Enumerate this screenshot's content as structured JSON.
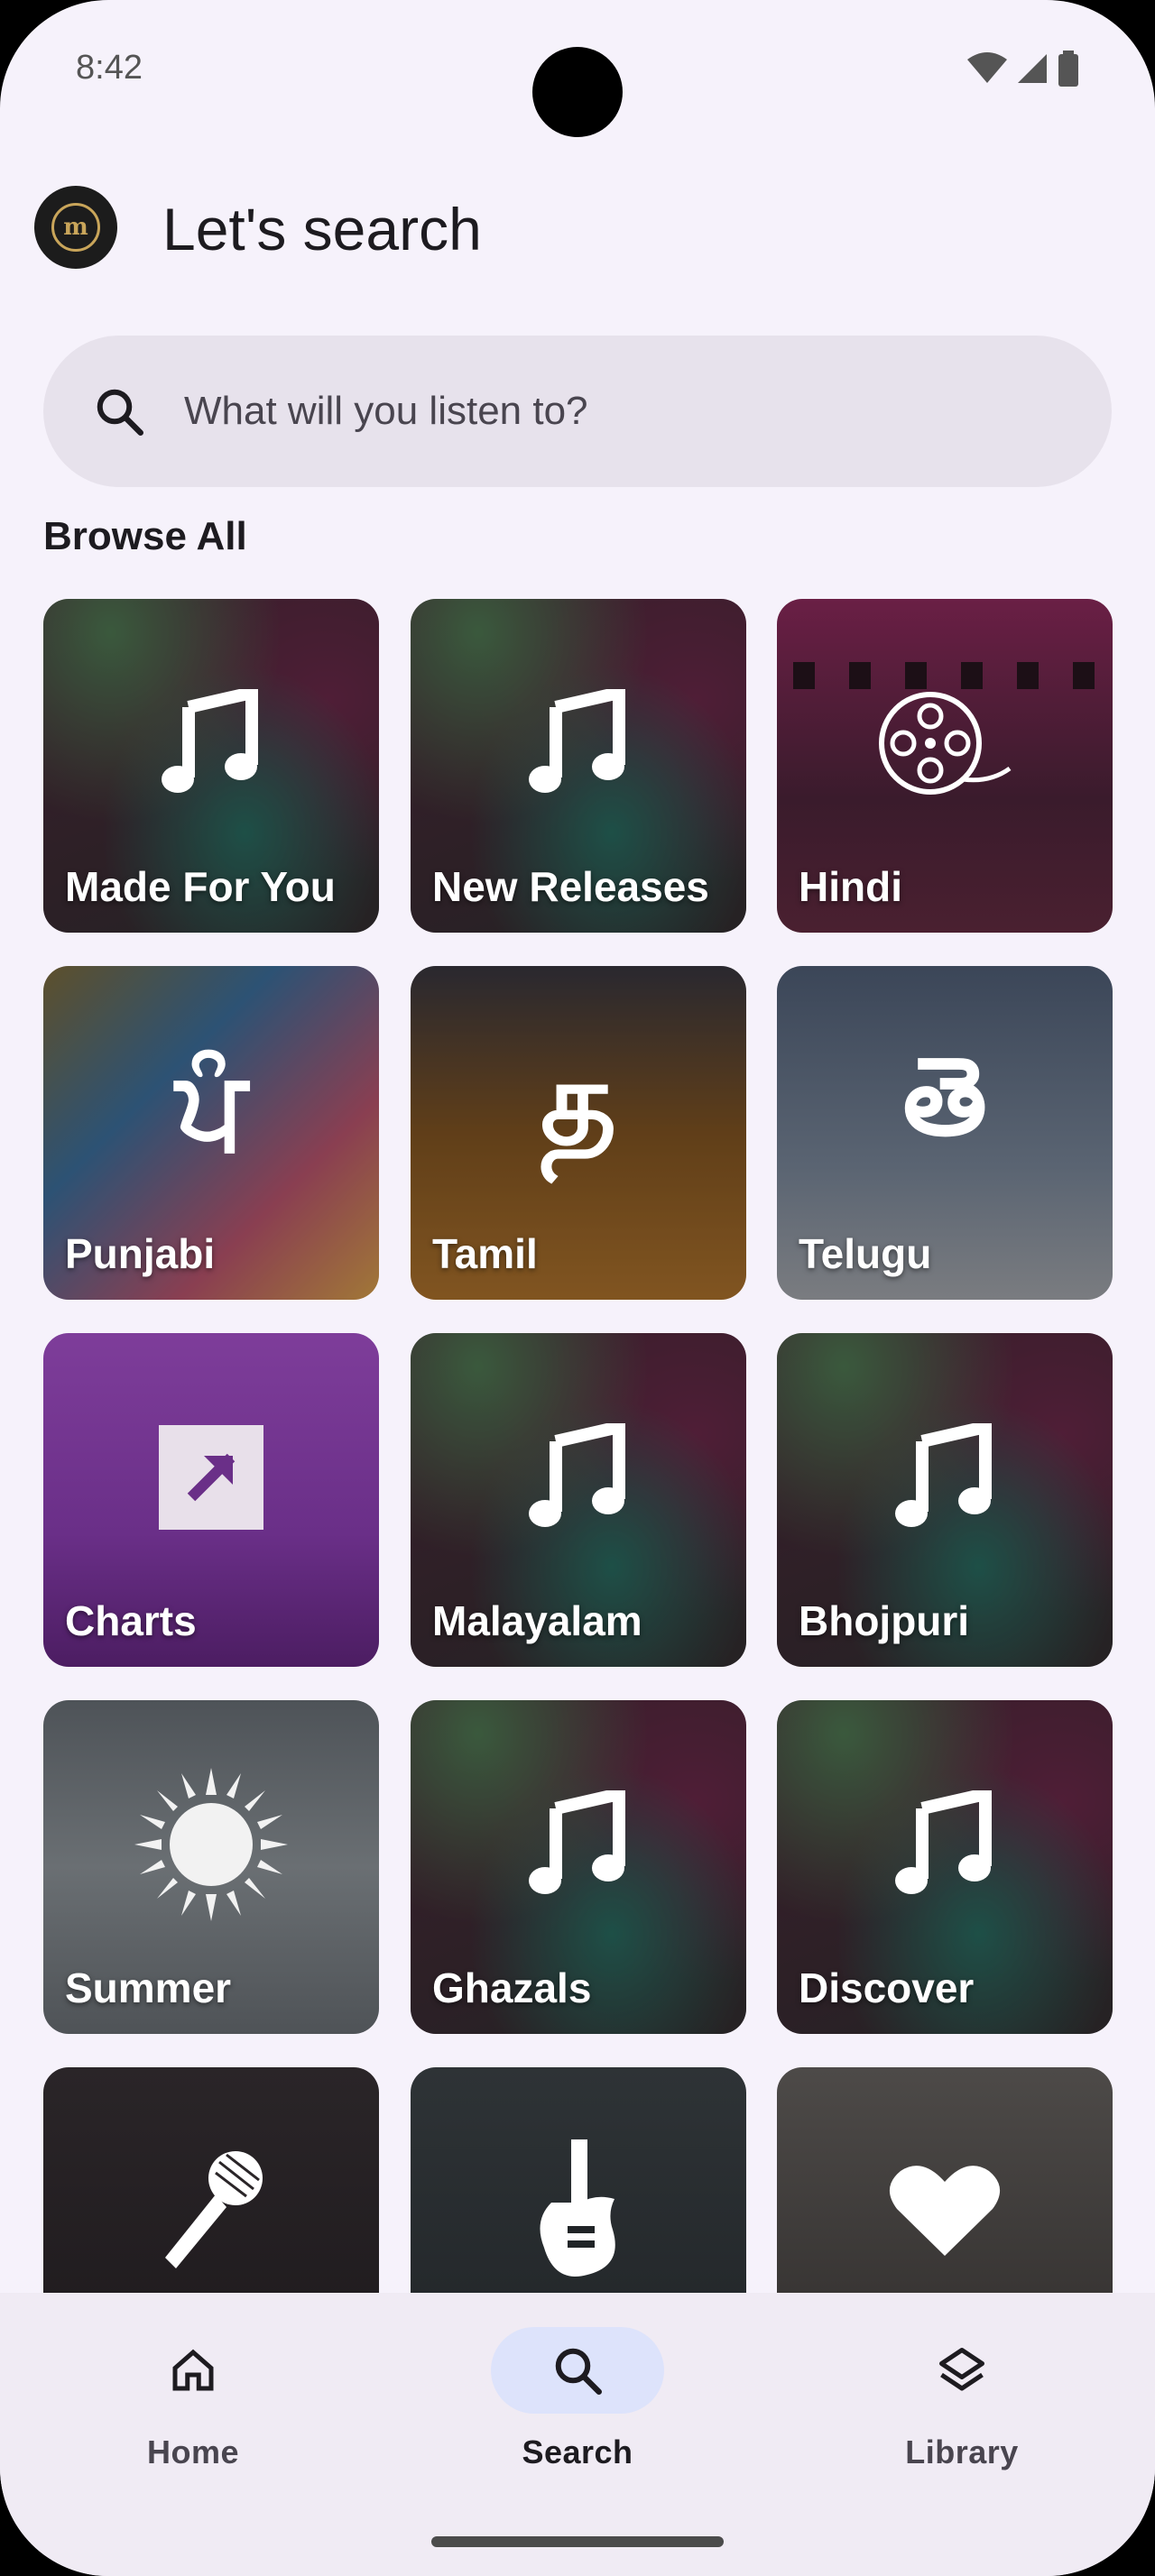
{
  "status_bar": {
    "time": "8:42"
  },
  "header": {
    "title": "Let's search",
    "logo_text": "m"
  },
  "search": {
    "placeholder": "What will you listen to?"
  },
  "browse": {
    "title": "Browse All",
    "tiles": [
      {
        "label": "Made For You",
        "icon": "music-note-icon"
      },
      {
        "label": "New Releases",
        "icon": "music-note-icon"
      },
      {
        "label": "Hindi",
        "icon": "film-reel-icon"
      },
      {
        "label": "Punjabi",
        "icon": "gurmukhi-letter-icon",
        "glyph": "ਪੰ"
      },
      {
        "label": "Tamil",
        "icon": "tamil-letter-icon",
        "glyph": "த"
      },
      {
        "label": "Telugu",
        "icon": "telugu-letter-icon",
        "glyph": "తె"
      },
      {
        "label": "Charts",
        "icon": "trending-arrow-icon"
      },
      {
        "label": "Malayalam",
        "icon": "music-note-icon"
      },
      {
        "label": "Bhojpuri",
        "icon": "music-note-icon"
      },
      {
        "label": "Summer",
        "icon": "sun-icon"
      },
      {
        "label": "Ghazals",
        "icon": "music-note-icon"
      },
      {
        "label": "Discover",
        "icon": "music-note-icon"
      },
      {
        "label": "",
        "icon": "microphone-icon"
      },
      {
        "label": "",
        "icon": "guitar-icon"
      },
      {
        "label": "",
        "icon": "heart-icon"
      }
    ]
  },
  "bottom_nav": {
    "items": [
      {
        "label": "Home",
        "icon": "home-icon"
      },
      {
        "label": "Search",
        "icon": "search-icon",
        "active": true
      },
      {
        "label": "Library",
        "icon": "layers-icon"
      }
    ]
  },
  "colors": {
    "background": "#f6f2fb",
    "search_bar": "#e7e2ec",
    "active_nav_pill": "#dde3fb"
  }
}
